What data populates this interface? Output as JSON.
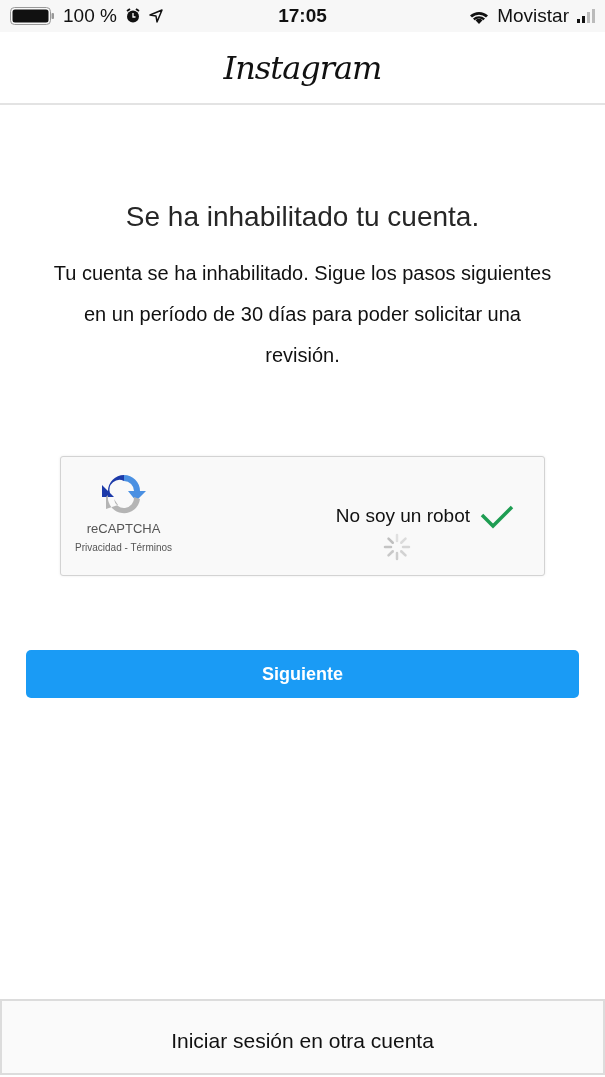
{
  "status_bar": {
    "carrier": "Movistar",
    "time": "17:05",
    "battery": "100 %"
  },
  "header": {
    "logo": "Instagram"
  },
  "title": "Se ha inhabilitado tu cuenta.",
  "message": "Tu cuenta se ha inhabilitado. Sigue los pasos siguientes en un período de 30 días para poder solicitar una revisión.",
  "captcha": {
    "label": "No soy un robot",
    "checked": true,
    "brand": "reCAPTCHA",
    "links": "Privacidad - Términos"
  },
  "next_button": "Siguiente",
  "footer_link": "Iniciar sesión en otra cuenta"
}
